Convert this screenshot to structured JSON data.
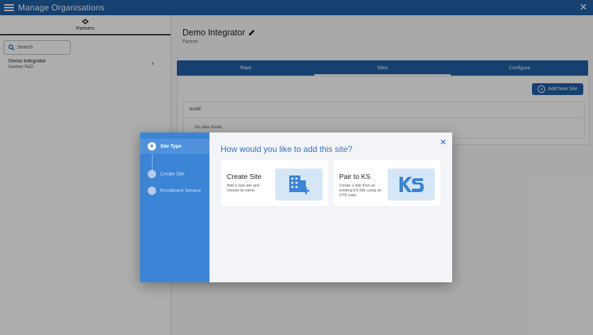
{
  "topbar": {
    "title": "Manage Organisations",
    "menu_icon": "menu-icon",
    "close_icon": "close-icon"
  },
  "sidebar": {
    "tab_label": "Partners",
    "search_placeholder": "Search",
    "items": [
      {
        "name": "Demo Integrator",
        "sub": "Gantner R&D"
      }
    ]
  },
  "main": {
    "title": "Demo Integrator",
    "subtitle": "Partner",
    "tabs": [
      {
        "label": "Team"
      },
      {
        "label": "Sites"
      },
      {
        "label": "Configure"
      }
    ],
    "active_tab": "Sites",
    "add_button": "Add New Site",
    "table": {
      "column": "NAME",
      "empty": "No sites found"
    }
  },
  "dialog": {
    "title": "How would you like to add this site?",
    "steps": [
      {
        "label": "Site Type"
      },
      {
        "label": "Create Site"
      },
      {
        "label": "Enrollment Service"
      }
    ],
    "active_step": "Site Type",
    "cards": [
      {
        "title": "Create Site",
        "desc": "Add a new site and choose its name."
      },
      {
        "title": "Pair to KS",
        "desc": "Create a Site from an existing KS Site using an OTP code."
      }
    ]
  },
  "colors": {
    "primary": "#1f5fa5",
    "stepper": "#3b84d6",
    "accent": "#2f72bf"
  }
}
